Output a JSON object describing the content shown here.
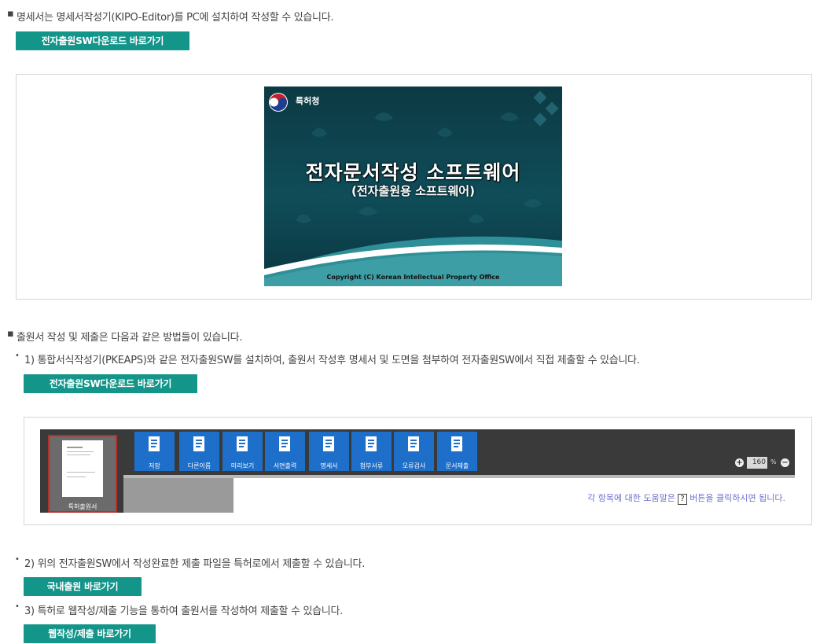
{
  "section1": {
    "bullet": "▪",
    "line": "명세서는 명세서작성기(KIPO-Editor)를 PC에 설치하여 작성할 수 있습니다.",
    "button": "전자출원SW다운로드 바로가기"
  },
  "splash": {
    "org": "특허청",
    "title": "전자문서작성 소프트웨어",
    "subtitle": "(전자출원용 소프트웨어)",
    "copyright": "Copyright (C) Korean Intellectual Property Office",
    "colors": {
      "bg": "#0f4d59",
      "wave": "#ffffff",
      "teal": "#2f8f98"
    }
  },
  "section2": {
    "bullet": "▪",
    "line": "출원서 작성 및 제출은 다음과 같은 방법들이 있습니다.",
    "item1": "1) 통합서식작성기(PKEAPS)와 같은 전자출원SW를 설치하여, 출원서 작성후 명세서 및 도면을 첨부하여 전자출원SW에서 직접 제출할 수 있습니다.",
    "button1": "전자출원SW다운로드 바로가기",
    "item2": "2) 위의 전자출원SW에서 작성완료한 제출 파일을 특허로에서 제출할 수 있습니다.",
    "button2": "국내출원 바로가기",
    "item3": "3) 특허로 웹작성/제출 기능을 통하여 출원서를 작성하여 제출할 수 있습니다.",
    "button3": "웹작성/제출 바로가기"
  },
  "editor": {
    "thumb_label": "특허출원서",
    "toolbar": [
      {
        "label": "저장",
        "icon": "save-icon"
      },
      {
        "label": "다른이름",
        "icon": "save-as-icon"
      },
      {
        "label": "미리보기",
        "icon": "preview-icon"
      },
      {
        "label": "서면출력",
        "icon": "print-icon"
      },
      {
        "label": "명세서",
        "icon": "document-icon"
      },
      {
        "label": "첨부서류",
        "icon": "attachment-icon"
      },
      {
        "label": "오류검사",
        "icon": "error-check-icon"
      },
      {
        "label": "문서제출",
        "icon": "submit-icon"
      }
    ],
    "zoom_value": "160",
    "zoom_unit": "%",
    "help_prefix": "각 항목에 대한 도움말은",
    "help_key": "?",
    "help_suffix": "버튼을 클릭하시면 됩니다."
  },
  "colors": {
    "button": "#13958a",
    "toolbar_button": "#1e6fc9"
  }
}
